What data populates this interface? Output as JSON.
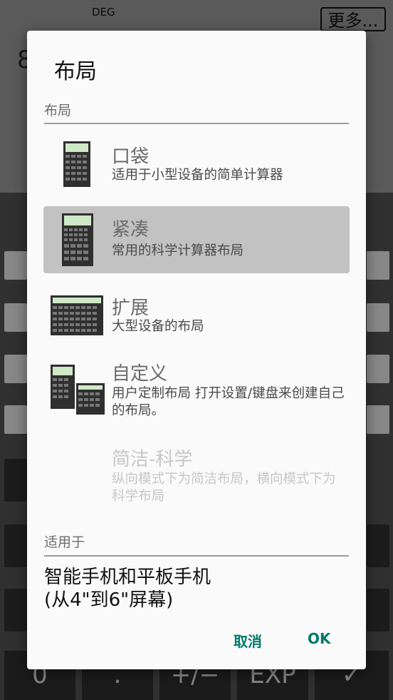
{
  "background": {
    "mode_indicator": "DEG",
    "more_button": "更多...",
    "display_partial": "8",
    "bottom_keys": [
      "0",
      ".",
      "+/−",
      "EXP",
      "✓"
    ]
  },
  "dialog": {
    "title": "布局",
    "section_label": "布局",
    "options": [
      {
        "title": "口袋",
        "desc": "适用于小型设备的简单计算器",
        "selected": false,
        "enabled": true
      },
      {
        "title": "紧凑",
        "desc": "常用的科学计算器布局",
        "selected": true,
        "enabled": true
      },
      {
        "title": "扩展",
        "desc": "大型设备的布局",
        "selected": false,
        "enabled": true
      },
      {
        "title": "自定义",
        "desc": "用户定制布局 打开设置/键盘来创建自己的布局。",
        "selected": false,
        "enabled": true
      },
      {
        "title": "简洁-科学",
        "desc": "纵向模式下为简洁布局，横向模式下为科学布局",
        "selected": false,
        "enabled": false
      }
    ],
    "suitable_label": "适用于",
    "suitable_text_line1": "智能手机和平板手机",
    "suitable_text_line2": "(从4\"到6\"屏幕)",
    "cancel_label": "取消",
    "ok_label": "OK",
    "accent_color": "#00796b"
  }
}
